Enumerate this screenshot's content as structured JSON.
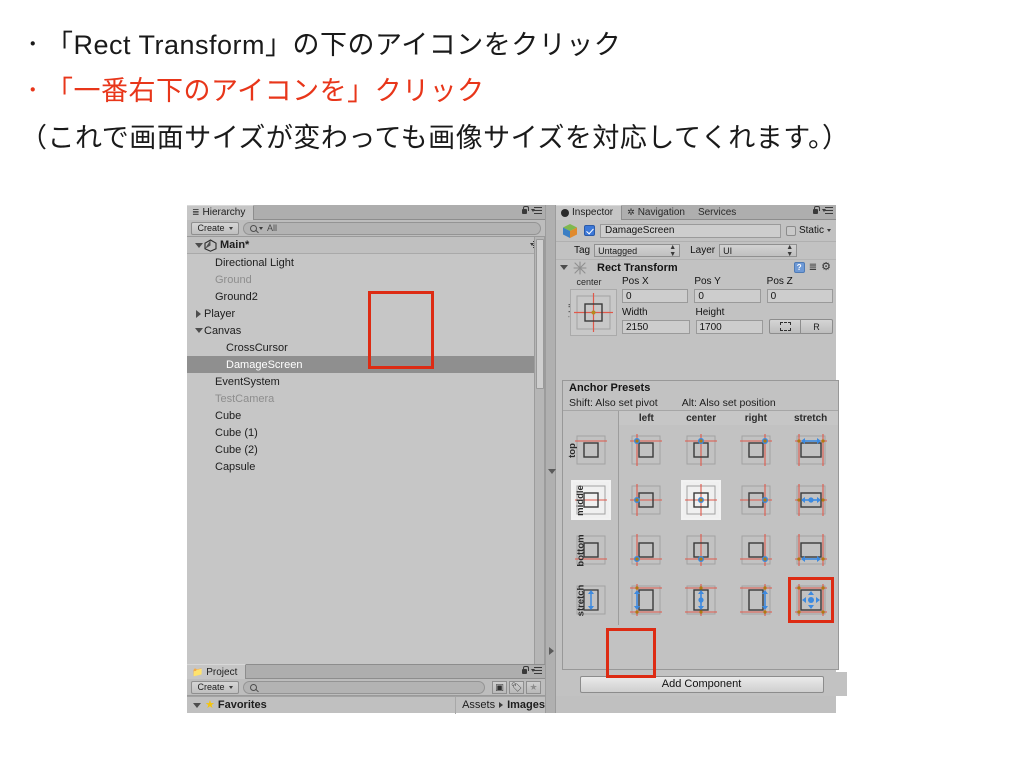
{
  "slide": {
    "bullets": [
      {
        "marker": "・",
        "text": "「Rect Transform」の下のアイコンをクリック",
        "color": "#1a1a1a"
      },
      {
        "marker": "・",
        "text": "「一番右下のアイコンを」クリック",
        "color": "#e8361a"
      }
    ],
    "note": "（これで画面サイズが変わっても画像サイズを対応してくれます。）",
    "accent_red": "#e8361a",
    "highlight_red": "#dd2b13"
  },
  "hierarchy": {
    "tab_label": "Hierarchy",
    "create_label": "Create",
    "search_placeholder": "All",
    "root": "Main*",
    "items": [
      {
        "label": "Directional Light",
        "indent": 2,
        "state": "normal",
        "arrow": "none"
      },
      {
        "label": "Ground",
        "indent": 2,
        "state": "dim",
        "arrow": "none"
      },
      {
        "label": "Ground2",
        "indent": 2,
        "state": "normal",
        "arrow": "none"
      },
      {
        "label": "Player",
        "indent": 1,
        "state": "normal",
        "arrow": "right"
      },
      {
        "label": "Canvas",
        "indent": 1,
        "state": "normal",
        "arrow": "down"
      },
      {
        "label": "CrossCursor",
        "indent": 3,
        "state": "normal",
        "arrow": "none"
      },
      {
        "label": "DamageScreen",
        "indent": 3,
        "state": "selected",
        "arrow": "none"
      },
      {
        "label": "EventSystem",
        "indent": 2,
        "state": "normal",
        "arrow": "none"
      },
      {
        "label": "TestCamera",
        "indent": 2,
        "state": "dim",
        "arrow": "none"
      },
      {
        "label": "Cube",
        "indent": 2,
        "state": "normal",
        "arrow": "none"
      },
      {
        "label": "Cube (1)",
        "indent": 2,
        "state": "normal",
        "arrow": "none"
      },
      {
        "label": "Cube (2)",
        "indent": 2,
        "state": "normal",
        "arrow": "none"
      },
      {
        "label": "Capsule",
        "indent": 2,
        "state": "normal",
        "arrow": "none"
      }
    ]
  },
  "project": {
    "tab_label": "Project",
    "create_label": "Create",
    "search_placeholder": "",
    "favorites_label": "Favorites",
    "breadcrumb": [
      "Assets",
      "Images"
    ]
  },
  "inspector": {
    "tabs": [
      {
        "label": "Inspector",
        "active": true
      },
      {
        "label": "Navigation",
        "active": false
      },
      {
        "label": "Services",
        "active": false
      }
    ],
    "object_name": "DamageScreen",
    "object_enabled": true,
    "static_label": "Static",
    "tag_label": "Tag",
    "tag_value": "Untagged",
    "layer_label": "Layer",
    "layer_value": "UI",
    "component_title": "Rect Transform",
    "anchor_button": {
      "h_label": "center",
      "v_label": "middle"
    },
    "fields": [
      {
        "label": "Pos X",
        "value": "0"
      },
      {
        "label": "Pos Y",
        "value": "0"
      },
      {
        "label": "Pos Z",
        "value": "0"
      },
      {
        "label": "Width",
        "value": "2150"
      },
      {
        "label": "Height",
        "value": "1700"
      }
    ],
    "blueprint_label": "",
    "raw_label": "R",
    "add_component_label": "Add Component"
  },
  "anchor_presets": {
    "title": "Anchor Presets",
    "hint_shift": "Shift: Also set pivot",
    "hint_alt": "Alt: Also set position",
    "columns": [
      "left",
      "center",
      "right",
      "stretch"
    ],
    "rows": [
      "top",
      "middle",
      "bottom",
      "stretch"
    ],
    "selected_cell": {
      "row": "middle",
      "column": "center"
    },
    "highlighted_cell": {
      "row": "stretch",
      "column": "stretch"
    }
  }
}
